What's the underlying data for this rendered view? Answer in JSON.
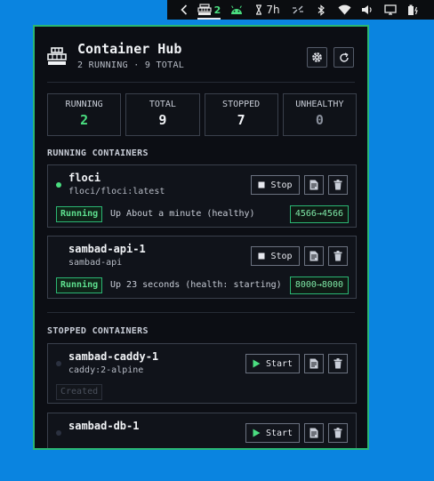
{
  "tray": {
    "hub_count": "2",
    "timer": "7h"
  },
  "app": {
    "title": "Container Hub",
    "subtitle": "2 RUNNING · 9 TOTAL"
  },
  "stats": [
    {
      "label": "RUNNING",
      "value": "2",
      "color": "#4ade80"
    },
    {
      "label": "TOTAL",
      "value": "9",
      "color": "#f1f3f6"
    },
    {
      "label": "STOPPED",
      "value": "7",
      "color": "#f1f3f6"
    },
    {
      "label": "UNHEALTHY",
      "value": "0",
      "color": "#8a909c"
    }
  ],
  "sections": {
    "running": "RUNNING CONTAINERS",
    "stopped": "STOPPED CONTAINERS"
  },
  "running": [
    {
      "name": "floci",
      "image": "floci/floci:latest",
      "status": "Running",
      "uptime": "Up About a minute (healthy)",
      "port": "4566→4566",
      "action": "Stop"
    },
    {
      "name": "sambad-api-1",
      "image": "sambad-api",
      "status": "Running",
      "uptime": "Up 23 seconds (health: starting)",
      "port": "8000→8000",
      "action": "Stop"
    }
  ],
  "stopped": [
    {
      "name": "sambad-caddy-1",
      "image": "caddy:2-alpine",
      "status": "Created",
      "action": "Start"
    },
    {
      "name": "sambad-db-1",
      "image": "",
      "action": "Start"
    }
  ],
  "colors": {
    "accent": "#2bb673",
    "running": "#4ade80",
    "panel_bg": "#0c0e14",
    "desktop": "#0a84e0"
  }
}
